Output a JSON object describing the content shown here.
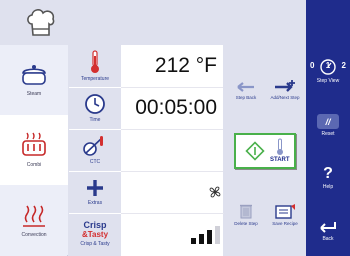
{
  "sidebar": {
    "step_view": {
      "icon": "step-view-icon",
      "label": "Step View",
      "glyph": "0 1 2"
    },
    "reset": {
      "icon": "reset-icon",
      "label": "Reset",
      "glyph": "//"
    },
    "help": {
      "icon": "help-icon",
      "label": "Help",
      "glyph": "?"
    },
    "back": {
      "icon": "back-arrow-icon",
      "label": "Back"
    }
  },
  "modes": [
    {
      "icon": "steam-pot-icon",
      "label": "Steam"
    },
    {
      "icon": "combi-pot-icon",
      "label": "Combi",
      "selected": true
    },
    {
      "icon": "convection-heat-icon",
      "label": "Convection"
    }
  ],
  "params": [
    {
      "icon": "thermometer-icon",
      "label": "Temperature"
    },
    {
      "icon": "clock-icon",
      "label": "Time"
    },
    {
      "icon": "core-temp-probe-icon",
      "label": "CTC"
    },
    {
      "icon": "plus-icon",
      "label": "Extras"
    },
    {
      "icon": "crisp-tasty-icon",
      "label": "Crisp & Tasty",
      "logo_line1": "Crisp",
      "logo_line2": "&Tasty"
    }
  ],
  "values": {
    "temperature": "212 °F",
    "time": "00:05:00",
    "ctc": "",
    "fan_icon": "fan-icon",
    "crisp_level": {
      "icon": "signal-bars-icon",
      "level": 0.75
    }
  },
  "steps": {
    "step_back": {
      "icon": "left-arrow-icon",
      "label": "Step Back"
    },
    "add_next_step": {
      "icon": "add-next-step-icon",
      "label": "Add/Next Step"
    },
    "start": {
      "icon": "start-icon",
      "label": "START"
    },
    "delete_step": {
      "icon": "trash-icon",
      "label": "Delete Step"
    },
    "save_recipe": {
      "icon": "save-recipe-icon",
      "label": "Save Recipe"
    }
  },
  "colors": {
    "sidebar_bg": "#1f2c8c",
    "accent_blue": "#2a3a8c",
    "start_green": "#49b04a",
    "thermo_red": "#d32f2f"
  }
}
